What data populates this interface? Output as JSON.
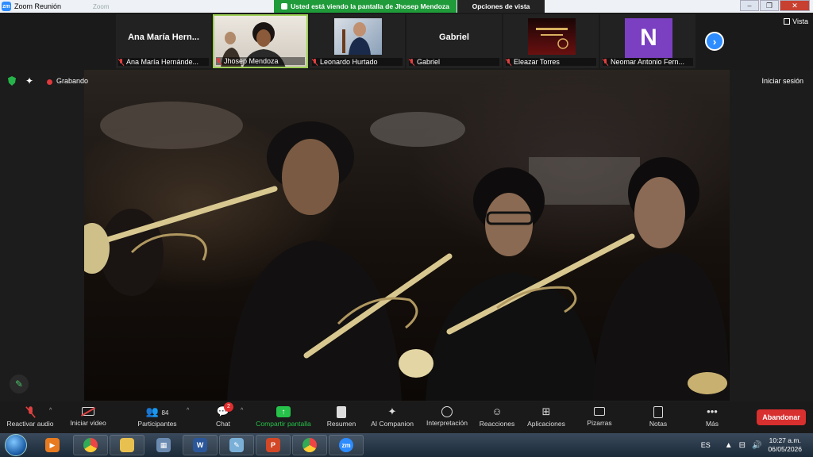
{
  "window": {
    "title": "Zoom Reunión",
    "ghost_tab": "Zoom",
    "logo_text": "zm"
  },
  "share_banner": {
    "text": "Usted está viendo la pantalla de Jhosep Mendoza",
    "view_options": "Opciones de vista"
  },
  "participants": [
    {
      "display": "Ana María Hern...",
      "label": "Ana María Hernánde...",
      "video": false
    },
    {
      "display": "",
      "label": "Jhosep Mendoza",
      "video": true,
      "active": true
    },
    {
      "display": "",
      "label": "Leonardo Hurtado",
      "video": true
    },
    {
      "display": "Gabriel",
      "label": "Gabriel",
      "video": false
    },
    {
      "display": "",
      "label": "Eleazar Torres",
      "video": true
    },
    {
      "display": "N",
      "label": "Neomar Antonio Fern...",
      "video": false
    }
  ],
  "strip": {
    "next_icon": "chevron-right-icon",
    "view_label": "Vista"
  },
  "status": {
    "recording_label": "Grabando",
    "signin_label": "Iniciar sesión"
  },
  "toolbar": {
    "mute": "Reactivar audio",
    "video": "Iniciar video",
    "participants": "Participantes",
    "participants_count": "84",
    "chat": "Chat",
    "chat_badge": "2",
    "share": "Compartir pantalla",
    "summary": "Resumen",
    "ai": "AI Companion",
    "interpretation": "Interpretación",
    "reactions": "Reacciones",
    "apps": "Aplicaciones",
    "whiteboards": "Pizarras",
    "notes": "Notas",
    "more": "Más",
    "leave": "Abandonar"
  },
  "taskbar": {
    "language": "ES",
    "time": "10:27 a.m.",
    "date": "06/05/2026",
    "apps": [
      "media-player",
      "chrome",
      "file-explorer",
      "calculator",
      "word",
      "paint",
      "presentation",
      "chrome",
      "zoom"
    ]
  },
  "colors": {
    "share_green": "#1f9b3a",
    "leave_red": "#d82f2f",
    "zoom_blue": "#2d8cff",
    "active_border": "#9ccf54"
  }
}
